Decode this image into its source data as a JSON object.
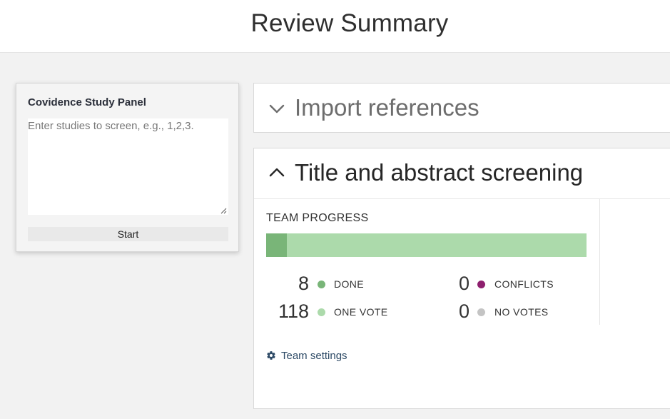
{
  "header": {
    "title": "Review Summary"
  },
  "study_panel": {
    "title": "Covidence Study Panel",
    "input_value": "",
    "input_placeholder": "Enter studies to screen, e.g., 1,2,3.",
    "start_label": "Start"
  },
  "import_section": {
    "title": "Import references",
    "expanded": false,
    "chevron_icon": "chevron-down-icon"
  },
  "screening_section": {
    "title": "Title and abstract screening",
    "expanded": true,
    "chevron_icon": "chevron-up-icon",
    "team_progress": {
      "label": "TEAM PROGRESS",
      "done_fraction": 0.0635,
      "stats": {
        "done": {
          "count": "8",
          "label": "DONE",
          "color": "#79b578"
        },
        "one_vote": {
          "count": "118",
          "label": "ONE VOTE",
          "color": "#acdaab"
        },
        "conflicts": {
          "count": "0",
          "label": "CONFLICTS",
          "color": "#8e1f6e"
        },
        "no_votes": {
          "count": "0",
          "label": "NO VOTES",
          "color": "#c4c4c4"
        }
      }
    },
    "team_settings": {
      "label": "Team settings",
      "icon": "gear-icon"
    }
  },
  "colors": {
    "background": "#f2f2f2",
    "progress_track": "#acdaab",
    "progress_fill": "#79b578",
    "link": "#2d4a66"
  }
}
